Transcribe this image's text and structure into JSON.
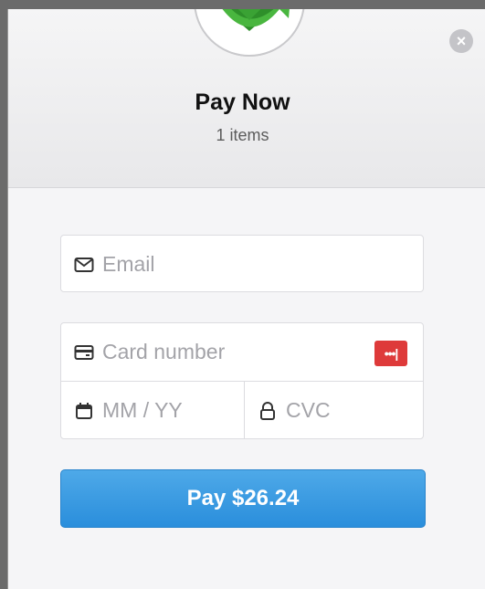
{
  "header": {
    "title": "Pay Now",
    "subtitle": "1 items"
  },
  "close": {
    "glyph": "×"
  },
  "form": {
    "email_placeholder": "Email",
    "card_number_placeholder": "Card number",
    "expiry_placeholder": "MM / YY",
    "cvc_placeholder": "CVC",
    "card_brand_glyph": "•••|"
  },
  "pay_button": {
    "label": "Pay $26.24"
  },
  "colors": {
    "accent": "#3a9ee4",
    "card_brand": "#de3a3a",
    "logo_green": "#3aa234"
  },
  "icons": {
    "logo": "green-arrows-logo-icon",
    "close": "close-icon",
    "email": "envelope-icon",
    "card": "credit-card-icon",
    "expiry": "calendar-icon",
    "cvc": "lock-icon",
    "brand": "card-brand-icon"
  }
}
